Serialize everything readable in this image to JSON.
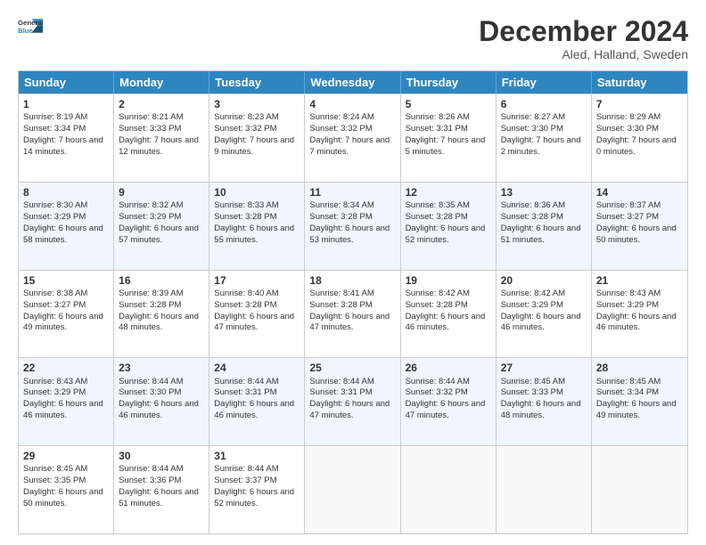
{
  "logo": {
    "line1": "General",
    "line2": "Blue"
  },
  "title": "December 2024",
  "subtitle": "Aled, Halland, Sweden",
  "days": [
    "Sunday",
    "Monday",
    "Tuesday",
    "Wednesday",
    "Thursday",
    "Friday",
    "Saturday"
  ],
  "weeks": [
    [
      {
        "day": 1,
        "rise": "8:19 AM",
        "set": "3:34 PM",
        "light": "7 hours and 14 minutes."
      },
      {
        "day": 2,
        "rise": "8:21 AM",
        "set": "3:33 PM",
        "light": "7 hours and 12 minutes."
      },
      {
        "day": 3,
        "rise": "8:23 AM",
        "set": "3:32 PM",
        "light": "7 hours and 9 minutes."
      },
      {
        "day": 4,
        "rise": "8:24 AM",
        "set": "3:32 PM",
        "light": "7 hours and 7 minutes."
      },
      {
        "day": 5,
        "rise": "8:26 AM",
        "set": "3:31 PM",
        "light": "7 hours and 5 minutes."
      },
      {
        "day": 6,
        "rise": "8:27 AM",
        "set": "3:30 PM",
        "light": "7 hours and 2 minutes."
      },
      {
        "day": 7,
        "rise": "8:29 AM",
        "set": "3:30 PM",
        "light": "7 hours and 0 minutes."
      }
    ],
    [
      {
        "day": 8,
        "rise": "8:30 AM",
        "set": "3:29 PM",
        "light": "6 hours and 58 minutes."
      },
      {
        "day": 9,
        "rise": "8:32 AM",
        "set": "3:29 PM",
        "light": "6 hours and 57 minutes."
      },
      {
        "day": 10,
        "rise": "8:33 AM",
        "set": "3:28 PM",
        "light": "6 hours and 55 minutes."
      },
      {
        "day": 11,
        "rise": "8:34 AM",
        "set": "3:28 PM",
        "light": "6 hours and 53 minutes."
      },
      {
        "day": 12,
        "rise": "8:35 AM",
        "set": "3:28 PM",
        "light": "6 hours and 52 minutes."
      },
      {
        "day": 13,
        "rise": "8:36 AM",
        "set": "3:28 PM",
        "light": "6 hours and 51 minutes."
      },
      {
        "day": 14,
        "rise": "8:37 AM",
        "set": "3:27 PM",
        "light": "6 hours and 50 minutes."
      }
    ],
    [
      {
        "day": 15,
        "rise": "8:38 AM",
        "set": "3:27 PM",
        "light": "6 hours and 49 minutes."
      },
      {
        "day": 16,
        "rise": "8:39 AM",
        "set": "3:28 PM",
        "light": "6 hours and 48 minutes."
      },
      {
        "day": 17,
        "rise": "8:40 AM",
        "set": "3:28 PM",
        "light": "6 hours and 47 minutes."
      },
      {
        "day": 18,
        "rise": "8:41 AM",
        "set": "3:28 PM",
        "light": "6 hours and 47 minutes."
      },
      {
        "day": 19,
        "rise": "8:42 AM",
        "set": "3:28 PM",
        "light": "6 hours and 46 minutes."
      },
      {
        "day": 20,
        "rise": "8:42 AM",
        "set": "3:29 PM",
        "light": "6 hours and 46 minutes."
      },
      {
        "day": 21,
        "rise": "8:43 AM",
        "set": "3:29 PM",
        "light": "6 hours and 46 minutes."
      }
    ],
    [
      {
        "day": 22,
        "rise": "8:43 AM",
        "set": "3:29 PM",
        "light": "6 hours and 46 minutes."
      },
      {
        "day": 23,
        "rise": "8:44 AM",
        "set": "3:30 PM",
        "light": "6 hours and 46 minutes."
      },
      {
        "day": 24,
        "rise": "8:44 AM",
        "set": "3:31 PM",
        "light": "6 hours and 46 minutes."
      },
      {
        "day": 25,
        "rise": "8:44 AM",
        "set": "3:31 PM",
        "light": "6 hours and 47 minutes."
      },
      {
        "day": 26,
        "rise": "8:44 AM",
        "set": "3:32 PM",
        "light": "6 hours and 47 minutes."
      },
      {
        "day": 27,
        "rise": "8:45 AM",
        "set": "3:33 PM",
        "light": "6 hours and 48 minutes."
      },
      {
        "day": 28,
        "rise": "8:45 AM",
        "set": "3:34 PM",
        "light": "6 hours and 49 minutes."
      }
    ],
    [
      {
        "day": 29,
        "rise": "8:45 AM",
        "set": "3:35 PM",
        "light": "6 hours and 50 minutes."
      },
      {
        "day": 30,
        "rise": "8:44 AM",
        "set": "3:36 PM",
        "light": "6 hours and 51 minutes."
      },
      {
        "day": 31,
        "rise": "8:44 AM",
        "set": "3:37 PM",
        "light": "6 hours and 52 minutes."
      },
      null,
      null,
      null,
      null
    ]
  ]
}
